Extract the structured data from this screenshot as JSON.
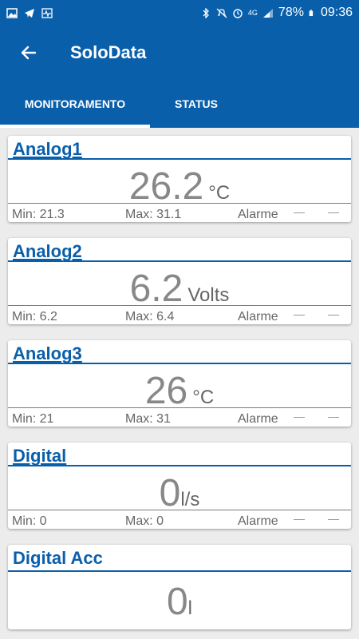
{
  "status_bar": {
    "battery": "78%",
    "time": "09:36",
    "network": "4G"
  },
  "app_bar": {
    "title": "SoloData"
  },
  "tabs": [
    {
      "label": "MONITORAMENTO",
      "active": true
    },
    {
      "label": "STATUS",
      "active": false
    }
  ],
  "cards": [
    {
      "title": "Analog1",
      "value": "26.2",
      "unit": "°C",
      "min": "Min: 21.3",
      "max": "Max: 31.1",
      "alarm": "Alarme"
    },
    {
      "title": "Analog2",
      "value": "6.2",
      "unit": "Volts",
      "min": "Min: 6.2",
      "max": "Max: 6.4",
      "alarm": "Alarme"
    },
    {
      "title": "Analog3",
      "value": "26",
      "unit": "°C",
      "min": "Min: 21",
      "max": "Max: 31",
      "alarm": "Alarme"
    },
    {
      "title": "Digital",
      "value": "0",
      "unit": "l/s",
      "min": "Min: 0",
      "max": "Max: 0",
      "alarm": "Alarme"
    },
    {
      "title": "Digital Acc",
      "value": "0",
      "unit": "l"
    }
  ],
  "colors": {
    "primary": "#0a5fab",
    "background": "#ececec",
    "value_text": "#888888"
  }
}
